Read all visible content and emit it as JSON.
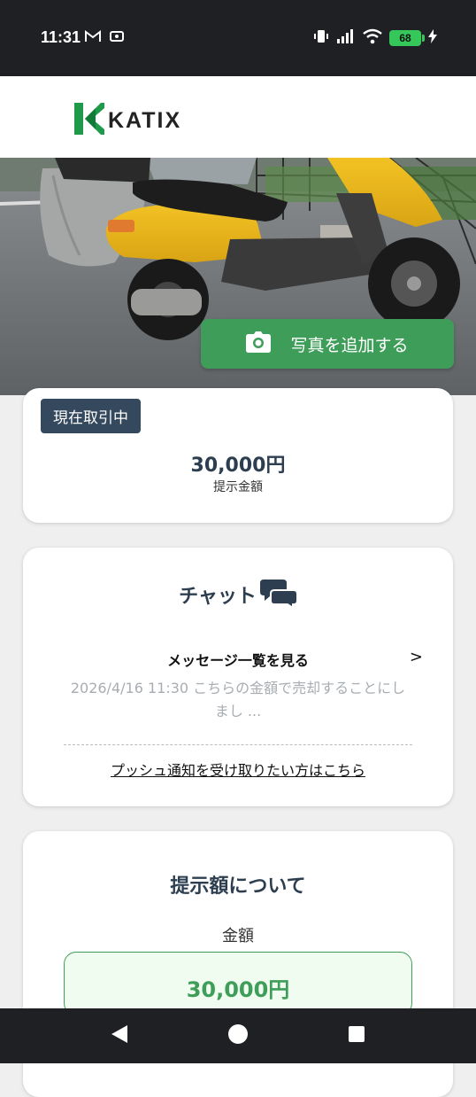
{
  "status_bar": {
    "time": "11:31",
    "battery": "68"
  },
  "header": {
    "logo_text": "KATIX"
  },
  "hero": {
    "add_photo_label": "写真を追加する"
  },
  "deal_card": {
    "badge": "現在取引中",
    "price": "30,000円",
    "price_label": "提示金額"
  },
  "chat_card": {
    "title": "チャット",
    "message_link": "メッセージ一覧を見る",
    "arrow": ">",
    "preview_line1": "2026/4/16 11:30 こちらの金額で売却することにし",
    "preview_line2": "まし ...",
    "push_link": "プッシュ通知を受け取りたい方はこちら"
  },
  "offer_card": {
    "title": "提示額について",
    "amount_label": "金額",
    "amount_value": "30,000円"
  },
  "colors": {
    "accent": "#3f9d5a",
    "badge": "#34495e",
    "heading": "#2c3e50"
  }
}
